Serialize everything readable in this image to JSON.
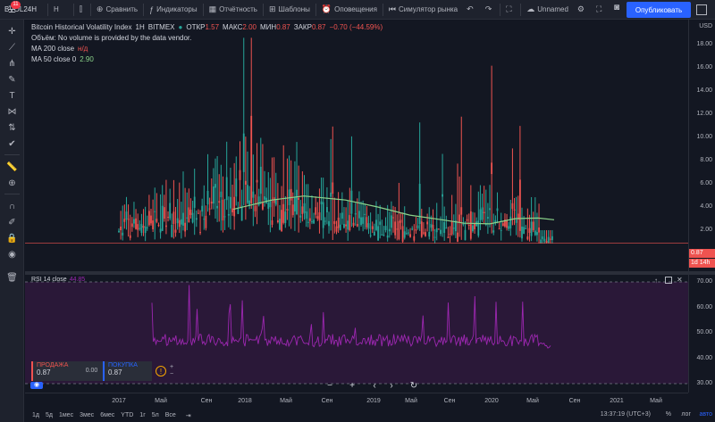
{
  "toolbar": {
    "symbol": "BVOL24H",
    "interval": "H",
    "compare": "Сравнить",
    "indicators": "Индикаторы",
    "reports": "Отчётность",
    "templates": "Шаблоны",
    "alerts": "Оповещения",
    "replay": "Симулятор рынка",
    "layout_name": "Unnamed",
    "publish": "Опубликовать",
    "notif_badge": "11"
  },
  "legend": {
    "title": "Bitcoin Historical Volatility Index",
    "interval": "1H",
    "exchange": "BITMEX",
    "o_label": "ОТКР",
    "o_value": "1.57",
    "h_label": "МАКС",
    "h_value": "2.00",
    "l_label": "МИН",
    "l_value": "0.87",
    "c_label": "ЗАКР",
    "c_value": "0.87",
    "change": "−0.70 (−44.59%)",
    "volume_note": "Объём: No volume is provided by the data vendor.",
    "ma200_label": "MA 200 close",
    "ma200_value": "н/д",
    "ma50_label": "MA 50 close 0",
    "ma50_value": "2.90"
  },
  "rsi_legend": {
    "label": "RSI 14 close",
    "value": "44.85"
  },
  "price_scale": {
    "currency": "USD",
    "ticks": [
      "18.00",
      "16.00",
      "14.00",
      "12.00",
      "10.00",
      "8.00",
      "6.00",
      "4.00",
      "2.00"
    ],
    "last_price": "0.87",
    "countdown": "1d 14h"
  },
  "rsi_scale": {
    "ticks": [
      "70.00",
      "60.00",
      "50.00",
      "40.00",
      "30.00"
    ]
  },
  "trade": {
    "sell_label": "ПРОДАЖА",
    "sell_value": "0.87",
    "spread": "0.00",
    "buy_label": "ПОКУПКА",
    "buy_value": "0.87"
  },
  "time_axis": {
    "labels": [
      "2017",
      "Май",
      "Сен",
      "2018",
      "Май",
      "Сен",
      "2019",
      "Май",
      "Сен",
      "2020",
      "Май",
      "Сен",
      "2021",
      "Май",
      "Сен"
    ]
  },
  "bottom": {
    "ranges": [
      "1д",
      "5д",
      "1мес",
      "3мес",
      "6мес",
      "YTD",
      "1г",
      "5л",
      "Все"
    ],
    "clock": "13:37:19 (UTC+3)",
    "pct": "%",
    "log": "лог",
    "auto": "авто"
  },
  "colors": {
    "up": "#26a69a",
    "down": "#ef5350",
    "ma50": "#8bd48a",
    "rsi": "#9c27b0",
    "accent": "#2962ff"
  },
  "chart_data": [
    {
      "type": "candlestick",
      "title": "Bitcoin Historical Volatility Index",
      "ylabel": "USD",
      "ylim": [
        0,
        19
      ],
      "x": [
        "2017",
        "Май",
        "Сен",
        "2018",
        "Май",
        "Сен",
        "2019",
        "Май",
        "Сен",
        "2020",
        "Май",
        "Сен",
        "2021"
      ],
      "series": [
        {
          "name": "MA 50 close 0",
          "values": [
            null,
            null,
            null,
            3.8,
            4.9,
            4.3,
            3.4,
            2.7,
            2.6,
            2.9,
            2.9,
            null,
            null
          ]
        }
      ],
      "approx_close_range": [
        0.8,
        18.0
      ],
      "last_close": 0.87
    },
    {
      "type": "line",
      "title": "RSI 14 close",
      "ylim": [
        30,
        70
      ],
      "x": [
        "2017",
        "Май",
        "Сен",
        "2018",
        "Май",
        "Сен",
        "2019",
        "Май",
        "Сен",
        "2020",
        "Май",
        "Сен",
        "2021"
      ],
      "series": [
        {
          "name": "RSI 14 close",
          "values": [
            50,
            53,
            52,
            54,
            50,
            47,
            52,
            49,
            48,
            52,
            50,
            45,
            null
          ]
        }
      ],
      "levels": [
        70,
        30
      ],
      "last_value": 44.85
    }
  ]
}
